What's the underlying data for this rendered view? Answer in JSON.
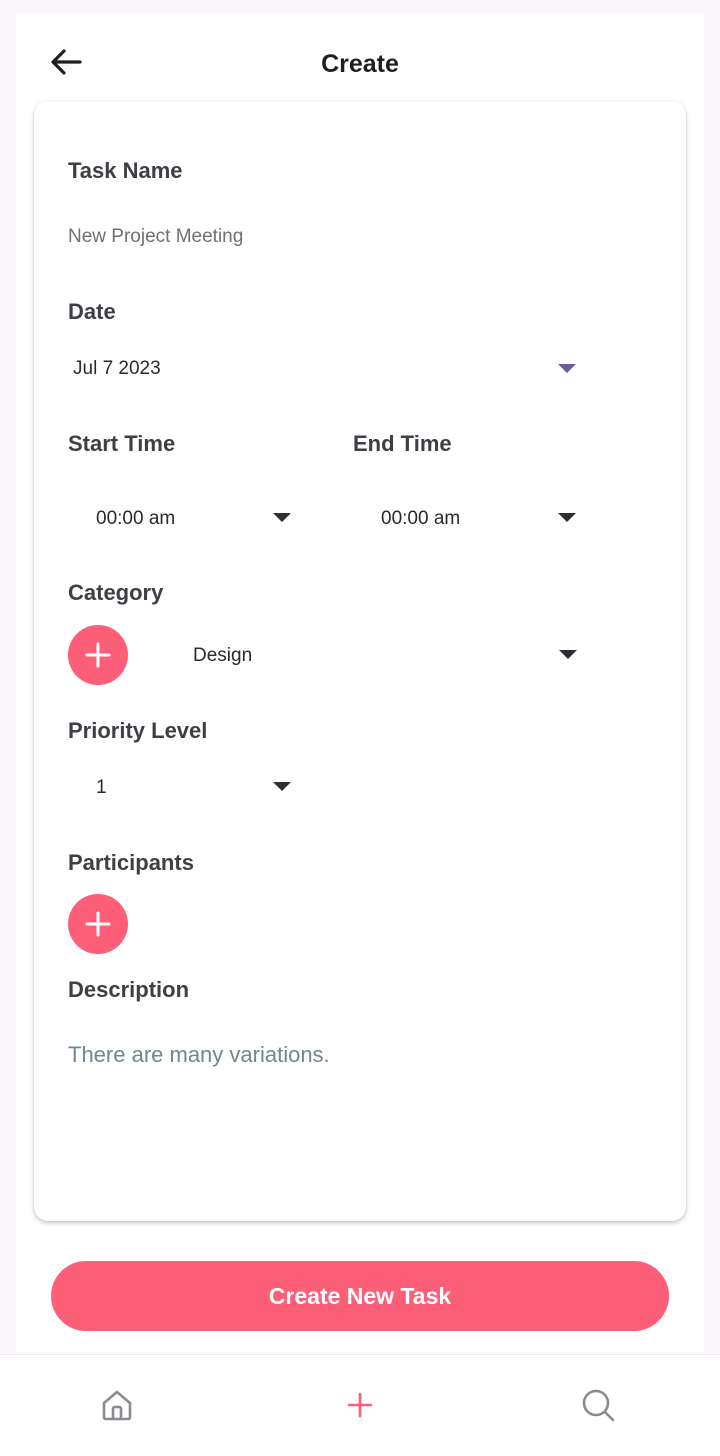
{
  "header": {
    "title": "Create",
    "back_icon": "arrow-left-icon"
  },
  "form": {
    "task_name": {
      "label": "Task Name",
      "value": "New Project Meeting"
    },
    "date": {
      "label": "Date",
      "value": "Jul 7 2023"
    },
    "start_time": {
      "label": "Start Time",
      "value": "00:00 am"
    },
    "end_time": {
      "label": "End Time",
      "value": "00:00 am"
    },
    "category": {
      "label": "Category",
      "value": "Design"
    },
    "priority": {
      "label": "Priority Level",
      "value": "1"
    },
    "participants": {
      "label": "Participants"
    },
    "description": {
      "label": "Description",
      "value": "There are many variations."
    }
  },
  "cta": {
    "label": "Create New Task"
  },
  "nav": {
    "items": [
      {
        "icon": "home-icon"
      },
      {
        "icon": "plus-icon"
      },
      {
        "icon": "search-icon"
      }
    ]
  },
  "colors": {
    "accent": "#fd5e78",
    "caret_purple": "#6d5a9e",
    "description_text": "#6e8790"
  }
}
